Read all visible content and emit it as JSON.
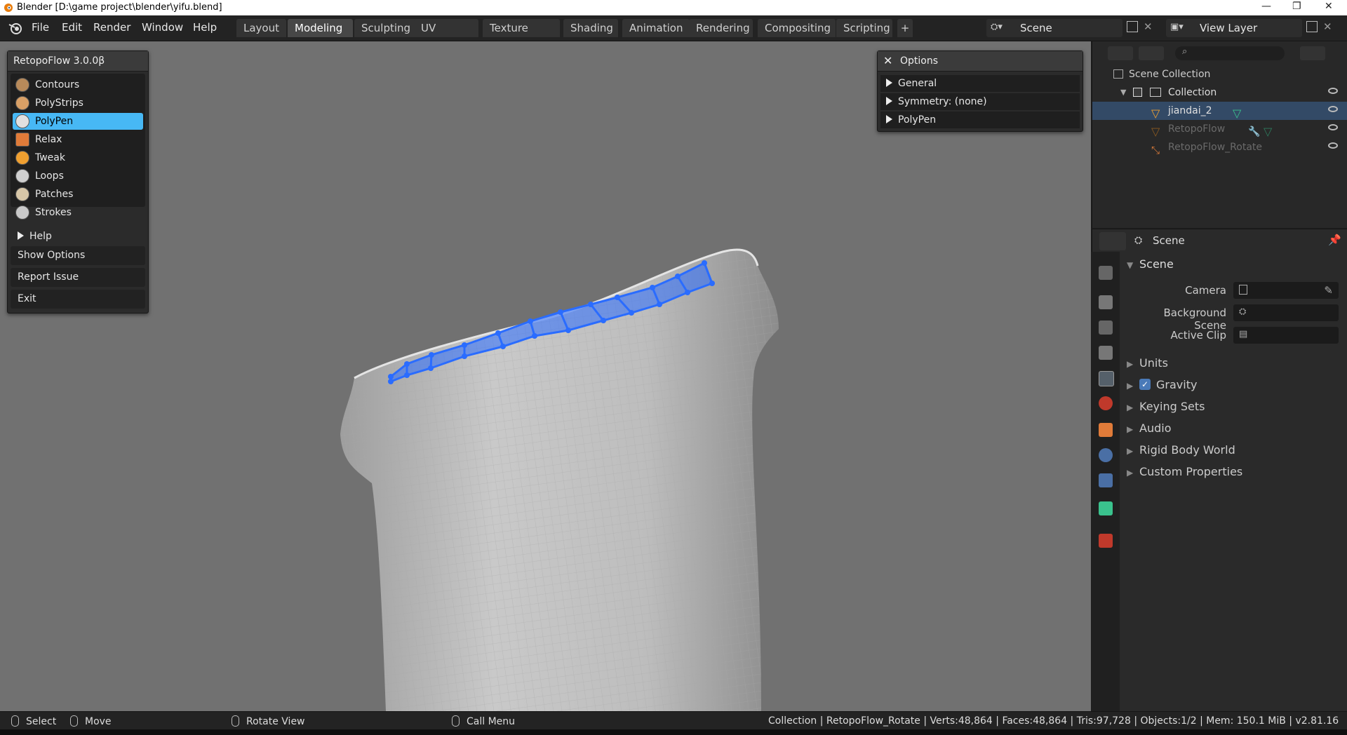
{
  "window": {
    "title": "Blender [D:\\game project\\blender\\yifu.blend]",
    "minimize_icon": "minimize-icon",
    "maximize_icon": "restore-icon",
    "close_icon": "close-icon"
  },
  "topbar": {
    "menu": [
      "File",
      "Edit",
      "Render",
      "Window",
      "Help"
    ],
    "workspaces": [
      "Layout",
      "Modeling",
      "Sculpting",
      "UV Editing",
      "Texture Paint",
      "Shading",
      "Animation",
      "Rendering",
      "Compositing",
      "Scripting"
    ],
    "active_workspace": "Modeling",
    "add_tab": "+",
    "scene": "Scene",
    "view_layer": "View Layer"
  },
  "retopoflow": {
    "title": "RetopoFlow 3.0.0β",
    "tools": [
      "Contours",
      "PolyStrips",
      "PolyPen",
      "Relax",
      "Tweak",
      "Loops",
      "Patches",
      "Strokes"
    ],
    "active_tool": "PolyPen",
    "help": "Help",
    "show_options": "Show Options",
    "report_issue": "Report Issue",
    "exit": "Exit"
  },
  "options": {
    "title": "Options",
    "rows": [
      "General",
      "Symmetry: (none)",
      "PolyPen"
    ]
  },
  "outliner": {
    "root": "Scene Collection",
    "items": [
      {
        "label": "Collection",
        "icon": "collection-icon"
      },
      {
        "label": "jiandai_2",
        "icon": "mesh-icon"
      },
      {
        "label": "RetopoFlow",
        "icon": "mesh-icon"
      },
      {
        "label": "RetopoFlow_Rotate",
        "icon": "object-icon"
      }
    ]
  },
  "properties": {
    "context": "Scene",
    "panel": "Scene",
    "fields": [
      {
        "label": "Camera"
      },
      {
        "label": "Background Scene"
      },
      {
        "label": "Active Clip"
      }
    ],
    "sections": [
      "Units",
      "Gravity",
      "Keying Sets",
      "Audio",
      "Rigid Body World",
      "Custom Properties"
    ],
    "gravity_checked": true
  },
  "statusbar": {
    "select": "Select",
    "move": "Move",
    "rotate": "Rotate View",
    "call_menu": "Call Menu",
    "stats": "Collection | RetopoFlow_Rotate | Verts:48,864 | Faces:48,864 | Tris:97,728 | Objects:1/2 | Mem: 150.1 MiB | v2.81.16"
  },
  "colors": {
    "accent": "#47b8f5",
    "viewport_bg": "#717171",
    "retopo_mesh": "#2a6cff"
  }
}
